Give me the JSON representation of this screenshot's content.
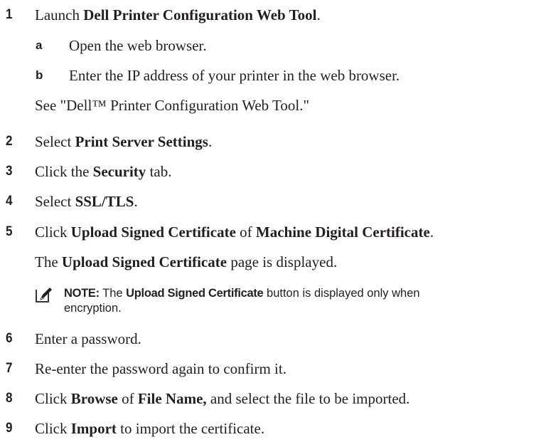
{
  "steps": [
    {
      "num": "1",
      "pre": "Launch ",
      "bold": "Dell Printer Configuration Web Tool",
      "post": "."
    },
    {
      "num": "2",
      "pre": "Select ",
      "bold": "Print Server Settings",
      "post": "."
    },
    {
      "num": "3",
      "pre": "Click the ",
      "bold": "Security",
      "post": " tab."
    },
    {
      "num": "4",
      "pre": "Select ",
      "bold": "SSL/TLS",
      "post": "."
    },
    {
      "num": "5",
      "pre": "Click ",
      "bold": "Upload Signed Certificate",
      "mid": " of ",
      "bold2": "Machine Digital Certificate",
      "post": "."
    },
    {
      "num": "6",
      "text": "Enter a password."
    },
    {
      "num": "7",
      "text": "Re-enter the password again to confirm it."
    },
    {
      "num": "8",
      "pre": "Click ",
      "bold": "Browse",
      "mid": " of ",
      "bold2": "File Name,",
      "post": " and select the file to be imported."
    },
    {
      "num": "9",
      "pre": "Click ",
      "bold": "Import",
      "post": " to import the certificate."
    }
  ],
  "substeps": [
    {
      "letter": "a",
      "text": "Open the web browser."
    },
    {
      "letter": "b",
      "text": "Enter the IP address of your printer in the web browser."
    }
  ],
  "see_line": "See \"Dell™ Printer Configuration Web Tool.\"",
  "step5_result": {
    "pre": "The ",
    "bold": "Upload Signed Certificate",
    "post": " page is displayed."
  },
  "note": {
    "icon": "pencil-note-icon",
    "label": "NOTE:",
    "pre": " The ",
    "bold": "Upload Signed Certificate",
    "post": " button is displayed only when",
    "line2": "encryption."
  }
}
